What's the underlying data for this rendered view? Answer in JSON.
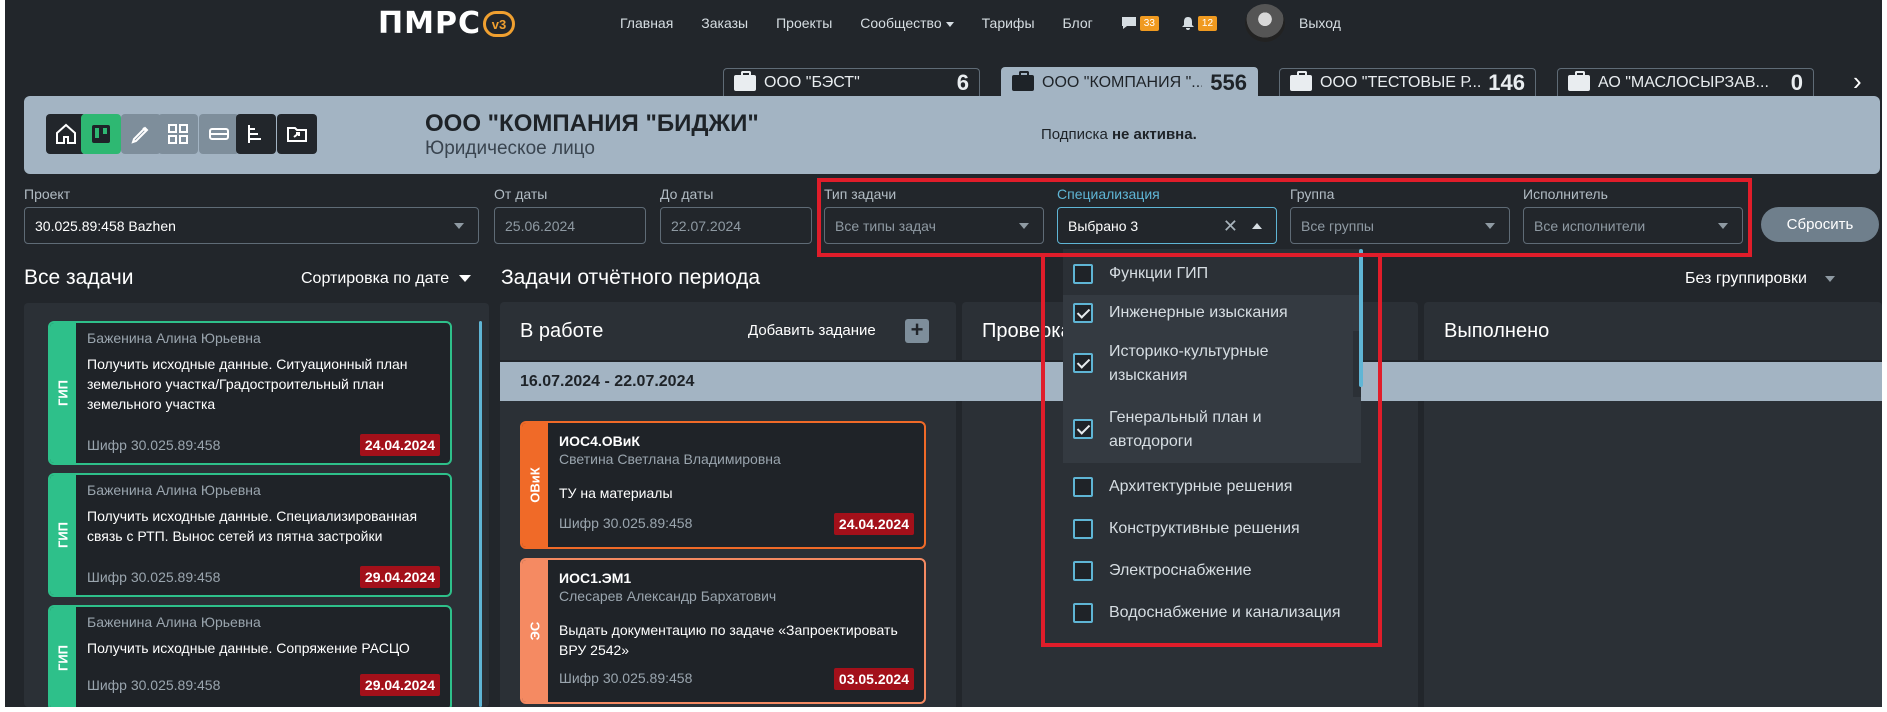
{
  "nav": {
    "logo": "ПМРС",
    "version": "v3",
    "items": [
      "Главная",
      "Заказы",
      "Проекты",
      "Сообщество",
      "Тарифы",
      "Блог"
    ],
    "messages_count": "33",
    "notifications_count": "12",
    "logout": "Выход"
  },
  "company_tabs": [
    {
      "name": "ООО \"БЭСТ\"",
      "count": "6"
    },
    {
      "name": "ООО \"КОМПАНИЯ \"...",
      "count": "556"
    },
    {
      "name": "ООО \"ТЕСТОВЫЕ Р...",
      "count": "146"
    },
    {
      "name": "АО \"МАСЛОСЫРЗАВ...",
      "count": "0"
    }
  ],
  "company": {
    "title": "ООО \"КОМПАНИЯ \"БИДЖИ\"",
    "subtitle": "Юридическое лицо",
    "subscription_prefix": "Подписка",
    "subscription_status": "не активна."
  },
  "filters": {
    "project": {
      "label": "Проект",
      "value": "30.025.89:458 Bazhen"
    },
    "from": {
      "label": "От даты",
      "value": "25.06.2024"
    },
    "to": {
      "label": "До даты",
      "value": "22.07.2024"
    },
    "task_type": {
      "label": "Тип задачи",
      "value": "Все типы задач"
    },
    "specialization": {
      "label": "Специализация",
      "value": "Выбрано 3"
    },
    "group": {
      "label": "Группа",
      "value": "Все группы"
    },
    "executor": {
      "label": "Исполнитель",
      "value": "Все исполнители"
    },
    "reset": "Сбросить"
  },
  "specialization_options": [
    {
      "label": "Функции ГИП",
      "checked": false
    },
    {
      "label": "Инженерные изыскания",
      "checked": true
    },
    {
      "label": "Историко-культурные изыскания",
      "checked": true
    },
    {
      "label": "Генеральный план и автодороги",
      "checked": true
    },
    {
      "label": "Архитектурные решения",
      "checked": false
    },
    {
      "label": "Конструктивные решения",
      "checked": false
    },
    {
      "label": "Электроснабжение",
      "checked": false
    },
    {
      "label": "Водоснабжение и канализация",
      "checked": false
    }
  ],
  "all_tasks": {
    "title": "Все задачи",
    "sort": "Сортировка по дате",
    "cards": [
      {
        "tag": "ГИП",
        "person": "Баженина Алина Юрьевна",
        "text": "Получить исходные данные. Ситуационный план земельного участка/Градостроительный план земельного участка",
        "cipher": "Шифр 30.025.89:458",
        "date": "24.04.2024"
      },
      {
        "tag": "ГИП",
        "person": "Баженина Алина Юрьевна",
        "text": "Получить исходные данные. Специализированная связь с РТП. Вынос сетей из пятна застройки",
        "cipher": "Шифр 30.025.89:458",
        "date": "29.04.2024"
      },
      {
        "tag": "ГИП",
        "person": "Баженина Алина Юрьевна",
        "text": "Получить исходные данные. Сопряжение РАСЦО",
        "cipher": "Шифр 30.025.89:458",
        "date": "29.04.2024"
      }
    ]
  },
  "period": {
    "title": "Задачи отчётного периода",
    "grouping": "Без группировки",
    "columns": [
      "В работе",
      "Проверка",
      "Выполнено"
    ],
    "add_task": "Добавить задание",
    "week": "16.07.2024 - 22.07.2024",
    "cards": [
      {
        "tag": "ОВиК",
        "code": "ИОС4.ОВиК",
        "person": "Светина Светлана Владимировна",
        "text": "ТУ на материалы",
        "cipher": "Шифр 30.025.89:458",
        "date": "24.04.2024"
      },
      {
        "tag": "ЭС",
        "code": "ИОС1.ЭМ1",
        "person": "Слесарев Александр Бархатович",
        "text": "Выдать документацию по задаче «Запроектировать ВРУ 2542»",
        "cipher": "Шифр 30.025.89:458",
        "date": "03.05.2024"
      }
    ]
  },
  "colors": {
    "bg": "#22262b",
    "panel": "#a3b4c3",
    "green": "#2ec08a",
    "orange": "#f06a28",
    "highlight": "#e01d2a",
    "accent": "#5fb5d5"
  }
}
